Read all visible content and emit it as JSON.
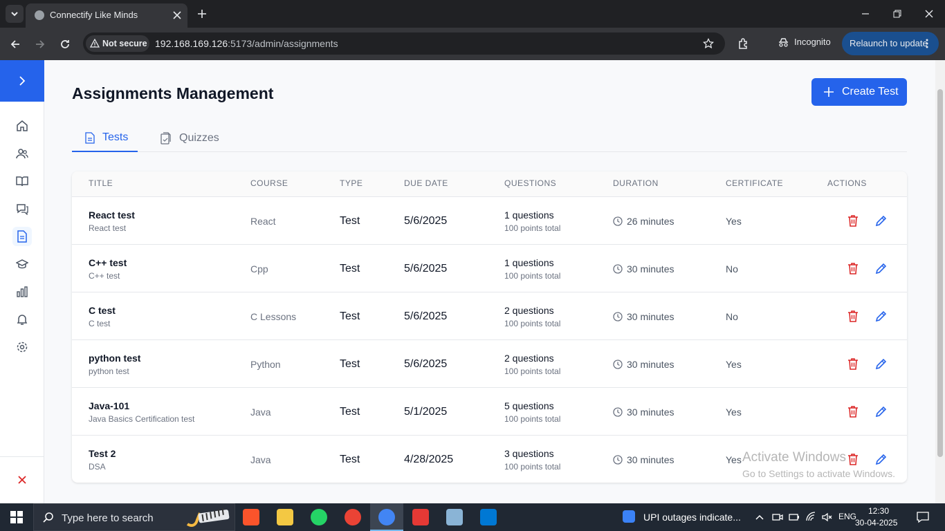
{
  "browser": {
    "tab_title": "Connectify Like Minds",
    "security_label": "Not secure",
    "url_host": "192.168.169.126",
    "url_path": ":5173/admin/assignments",
    "incognito_label": "Incognito",
    "relaunch_label": "Relaunch to update"
  },
  "page": {
    "title": "Assignments Management",
    "create_button": "Create Test",
    "tabs": [
      {
        "label": "Tests",
        "active": true
      },
      {
        "label": "Quizzes",
        "active": false
      }
    ]
  },
  "table": {
    "headers": [
      "TITLE",
      "COURSE",
      "TYPE",
      "DUE DATE",
      "QUESTIONS",
      "DURATION",
      "CERTIFICATE",
      "ACTIONS"
    ],
    "rows": [
      {
        "title": "React test",
        "subtitle": "React test",
        "course": "React",
        "type": "Test",
        "due": "5/6/2025",
        "questions": "1 questions",
        "points": "100 points total",
        "duration": "26 minutes",
        "certificate": "Yes"
      },
      {
        "title": "C++ test",
        "subtitle": "C++ test",
        "course": "Cpp",
        "type": "Test",
        "due": "5/6/2025",
        "questions": "1 questions",
        "points": "100 points total",
        "duration": "30 minutes",
        "certificate": "No"
      },
      {
        "title": "C test",
        "subtitle": "C test",
        "course": "C Lessons",
        "type": "Test",
        "due": "5/6/2025",
        "questions": "2 questions",
        "points": "100 points total",
        "duration": "30 minutes",
        "certificate": "No"
      },
      {
        "title": "python test",
        "subtitle": "python test",
        "course": "Python",
        "type": "Test",
        "due": "5/6/2025",
        "questions": "2 questions",
        "points": "100 points total",
        "duration": "30 minutes",
        "certificate": "Yes"
      },
      {
        "title": "Java-101",
        "subtitle": "Java Basics Certification test",
        "course": "Java",
        "type": "Test",
        "due": "5/1/2025",
        "questions": "5 questions",
        "points": "100 points total",
        "duration": "30 minutes",
        "certificate": "Yes"
      },
      {
        "title": "Test 2",
        "subtitle": "DSA",
        "course": "Java",
        "type": "Test",
        "due": "4/28/2025",
        "questions": "3 questions",
        "points": "100 points total",
        "duration": "30 minutes",
        "certificate": "Yes"
      }
    ]
  },
  "sidebar": {
    "icons": [
      "home-icon",
      "users-icon",
      "book-icon",
      "chat-icon",
      "document-icon",
      "graduation-cap-icon",
      "chart-icon",
      "bell-icon",
      "settings-icon"
    ],
    "active_index": 4
  },
  "watermark": {
    "line1": "Activate Windows",
    "line2": "Go to Settings to activate Windows."
  },
  "taskbar": {
    "search_placeholder": "Type here to search",
    "news": "UPI outages indicate...",
    "language": "ENG",
    "time": "12:30",
    "date": "30-04-2025"
  },
  "colors": {
    "accent": "#2563eb",
    "delete": "#dc2626",
    "browser_dark": "#202124"
  }
}
